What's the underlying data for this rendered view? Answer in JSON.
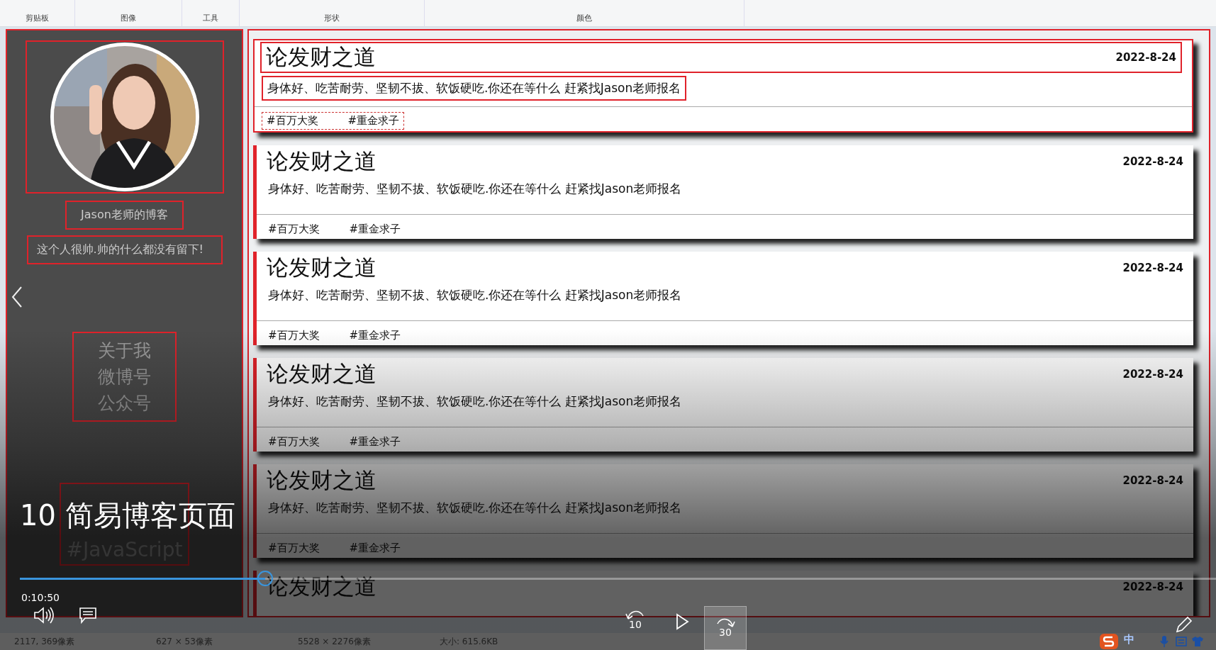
{
  "ribbon": {
    "groups": [
      "剪贴板",
      "图像",
      "工具",
      "形状",
      "颜色"
    ]
  },
  "sidebar": {
    "profile_photo": {
      "kind": "picture"
    },
    "blog_name": "Jason老师的博客",
    "bio": "这个人很帅.帅的什么都没有留下!",
    "nav": [
      "关于我",
      "微博号",
      "公众号"
    ],
    "tags": [
      "#JavaScript"
    ]
  },
  "posts": [
    {
      "title": "论发财之道",
      "date": "2022-8-24",
      "summary": "身体好、吃苦耐劳、坚韧不拔、软饭硬吃.你还在等什么 赶紧找Jason老师报名",
      "tags": [
        "#百万大奖",
        "#重金求子"
      ],
      "outlined": true
    },
    {
      "title": "论发财之道",
      "date": "2022-8-24",
      "summary": "身体好、吃苦耐劳、坚韧不拔、软饭硬吃.你还在等什么 赶紧找Jason老师报名",
      "tags": [
        "#百万大奖",
        "#重金求子"
      ],
      "outlined": false
    },
    {
      "title": "论发财之道",
      "date": "2022-8-24",
      "summary": "身体好、吃苦耐劳、坚韧不拔、软饭硬吃.你还在等什么 赶紧找Jason老师报名",
      "tags": [
        "#百万大奖",
        "#重金求子"
      ],
      "outlined": false
    },
    {
      "title": "论发财之道",
      "date": "2022-8-24",
      "summary": "身体好、吃苦耐劳、坚韧不拔、软饭硬吃.你还在等什么 赶紧找Jason老师报名",
      "tags": [
        "#百万大奖",
        "#重金求子"
      ],
      "outlined": false
    },
    {
      "title": "论发财之道",
      "date": "2022-8-24",
      "summary": "身体好、吃苦耐劳、坚韧不拔、软饭硬吃.你还在等什么 赶紧找Jason老师报名",
      "tags": [
        "#百万大奖",
        "#重金求子"
      ],
      "outlined": false
    },
    {
      "title": "论发财之道",
      "date": "2022-8-24",
      "outlined": false
    }
  ],
  "video": {
    "title": "10 简易博客页面",
    "time": "0:10:50",
    "progress": {
      "level": 0.205
    },
    "rewind_label": "10",
    "forward_label": "30"
  },
  "status_bar": [
    "2117, 369像素",
    "627 × 53像素",
    "5528 × 2276像素",
    "大小: 615.6KB"
  ],
  "tray": {
    "ime": "中"
  }
}
